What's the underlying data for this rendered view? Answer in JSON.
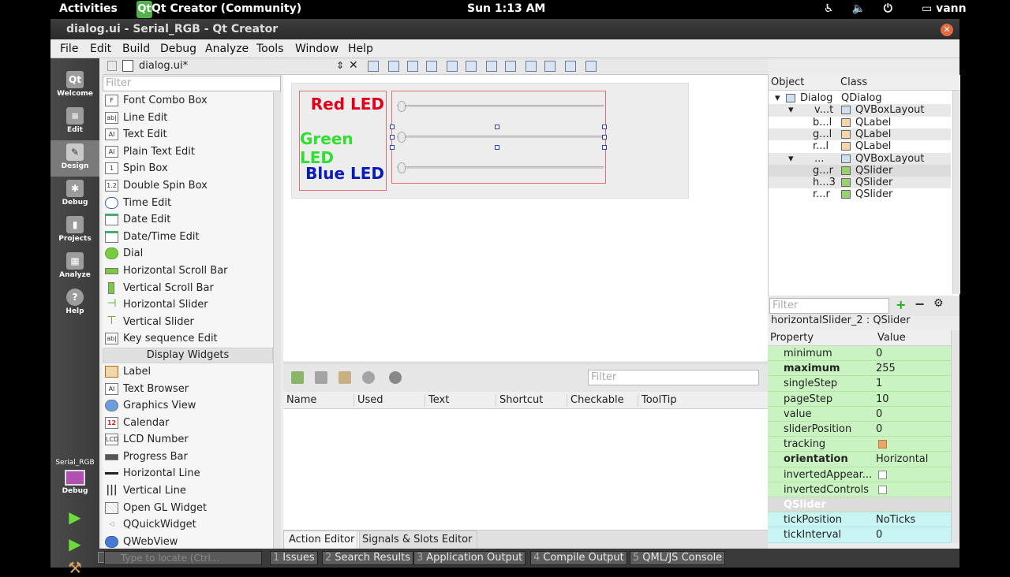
{
  "topbar": {
    "activities": "Activities",
    "app_icon": "Qt",
    "app_name": "Qt Creator (Community)",
    "clock": "Sun  1:13 AM",
    "user": "vann"
  },
  "window": {
    "title": "dialog.ui - Serial_RGB - Qt Creator"
  },
  "menu": [
    "File",
    "Edit",
    "Build",
    "Debug",
    "Analyze",
    "Tools",
    "Window",
    "Help"
  ],
  "modes": [
    "Welcome",
    "Edit",
    "Design",
    "Debug",
    "Projects",
    "Analyze",
    "Help"
  ],
  "kit": {
    "project": "Serial_RGB",
    "config": "Debug"
  },
  "editor": {
    "document": "dialog.ui*"
  },
  "widget_box": {
    "filter_placeholder": "Filter",
    "items": [
      "Font Combo Box",
      "Line Edit",
      "Text Edit",
      "Plain Text Edit",
      "Spin Box",
      "Double Spin Box",
      "Time Edit",
      "Date Edit",
      "Date/Time Edit",
      "Dial",
      "Horizontal Scroll Bar",
      "Vertical Scroll Bar",
      "Horizontal Slider",
      "Vertical Slider",
      "Key sequence Edit"
    ],
    "category": "Display Widgets",
    "display_items": [
      "Label",
      "Text Browser",
      "Graphics View",
      "Calendar",
      "LCD Number",
      "Progress Bar",
      "Horizontal Line",
      "Vertical Line",
      "Open GL Widget",
      "QQuickWidget",
      "QWebView"
    ]
  },
  "form": {
    "labels": [
      {
        "text": "Red LED",
        "color": "#e0001a"
      },
      {
        "text": "Green LED",
        "color": "#2fe02f"
      },
      {
        "text": "Blue LED",
        "color": "#0a1ab8"
      }
    ]
  },
  "action_editor": {
    "filter_placeholder": "Filter",
    "columns": [
      "Name",
      "Used",
      "Text",
      "Shortcut",
      "Checkable",
      "ToolTip"
    ],
    "tabs": [
      "Action Editor",
      "Signals & Slots Editor"
    ]
  },
  "object_inspector": {
    "headers": [
      "Object",
      "Class"
    ],
    "rows": [
      {
        "name": "Dialog",
        "class": "QDialog"
      },
      {
        "name": "v...t",
        "class": "QVBoxLayout"
      },
      {
        "name": "b...l",
        "class": "QLabel"
      },
      {
        "name": "g...l",
        "class": "QLabel"
      },
      {
        "name": "r...l",
        "class": "QLabel"
      },
      {
        "name": "...",
        "class": "QVBoxLayout"
      },
      {
        "name": "g...r",
        "class": "QSlider"
      },
      {
        "name": "h...3",
        "class": "QSlider"
      },
      {
        "name": "r...r",
        "class": "QSlider"
      }
    ]
  },
  "property_editor": {
    "filter_placeholder": "Filter",
    "object": "horizontalSlider_2 : QSlider",
    "headers": [
      "Property",
      "Value"
    ],
    "rows": [
      {
        "name": "minimum",
        "value": "0"
      },
      {
        "name": "maximum",
        "value": "255"
      },
      {
        "name": "singleStep",
        "value": "1"
      },
      {
        "name": "pageStep",
        "value": "10"
      },
      {
        "name": "value",
        "value": "0"
      },
      {
        "name": "sliderPosition",
        "value": "0"
      },
      {
        "name": "tracking",
        "value": ""
      },
      {
        "name": "orientation",
        "value": "Horizontal"
      },
      {
        "name": "invertedAppear...",
        "value": ""
      },
      {
        "name": "invertedControls",
        "value": ""
      },
      {
        "name": "QSlider",
        "value": ""
      },
      {
        "name": "tickPosition",
        "value": "NoTicks"
      },
      {
        "name": "tickInterval",
        "value": "0"
      }
    ]
  },
  "statusbar": {
    "locator_placeholder": "Type to locate (Ctrl...",
    "panes": [
      {
        "num": "1",
        "label": "Issues"
      },
      {
        "num": "2",
        "label": "Search Results"
      },
      {
        "num": "3",
        "label": "Application Output"
      },
      {
        "num": "4",
        "label": "Compile Output"
      },
      {
        "num": "5",
        "label": "QML/JS Console"
      }
    ]
  }
}
